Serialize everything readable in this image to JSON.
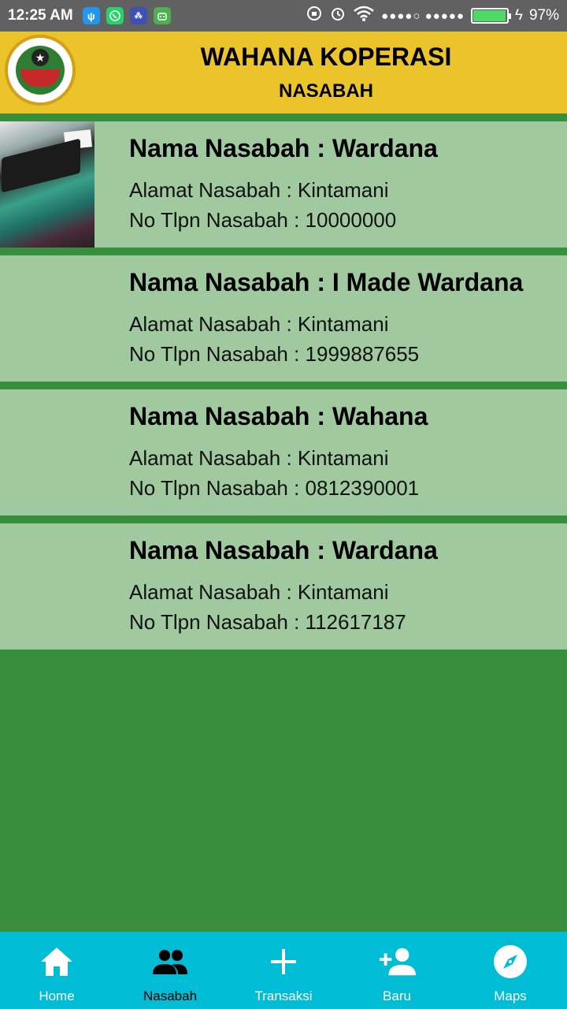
{
  "status_bar": {
    "time": "12:25 AM",
    "battery_percent": "97%",
    "battery_level": 0.97,
    "signal_dots": "●●●●○ ●●●●●"
  },
  "header": {
    "title": "WAHANA KOPERASI",
    "subtitle": "NASABAH"
  },
  "customers": [
    {
      "name": "Nama Nasabah : Wardana",
      "address": "Alamat Nasabah : Kintamani",
      "phone": "No Tlpn Nasabah : 10000000"
    },
    {
      "name": "Nama Nasabah : I Made Wardana",
      "address": "Alamat Nasabah : Kintamani",
      "phone": "No Tlpn Nasabah : 1999887655"
    },
    {
      "name": "Nama Nasabah : Wahana",
      "address": "Alamat Nasabah : Kintamani",
      "phone": "No Tlpn Nasabah : 0812390001"
    },
    {
      "name": "Nama Nasabah : Wardana",
      "address": "Alamat Nasabah : Kintamani",
      "phone": "No Tlpn Nasabah : 112617187"
    }
  ],
  "nav": {
    "items": [
      {
        "label": "Home",
        "icon": "home-icon"
      },
      {
        "label": "Nasabah",
        "icon": "people-icon"
      },
      {
        "label": "Transaksi",
        "icon": "plus-icon"
      },
      {
        "label": "Baru",
        "icon": "add-person-icon"
      },
      {
        "label": "Maps",
        "icon": "compass-icon"
      }
    ],
    "active_index": 1
  },
  "colors": {
    "header_bg": "#ebc32b",
    "page_bg": "#388e3c",
    "card_bg": "#a0c99f",
    "nav_bg": "#00bcd4",
    "status_bg": "#616161"
  }
}
